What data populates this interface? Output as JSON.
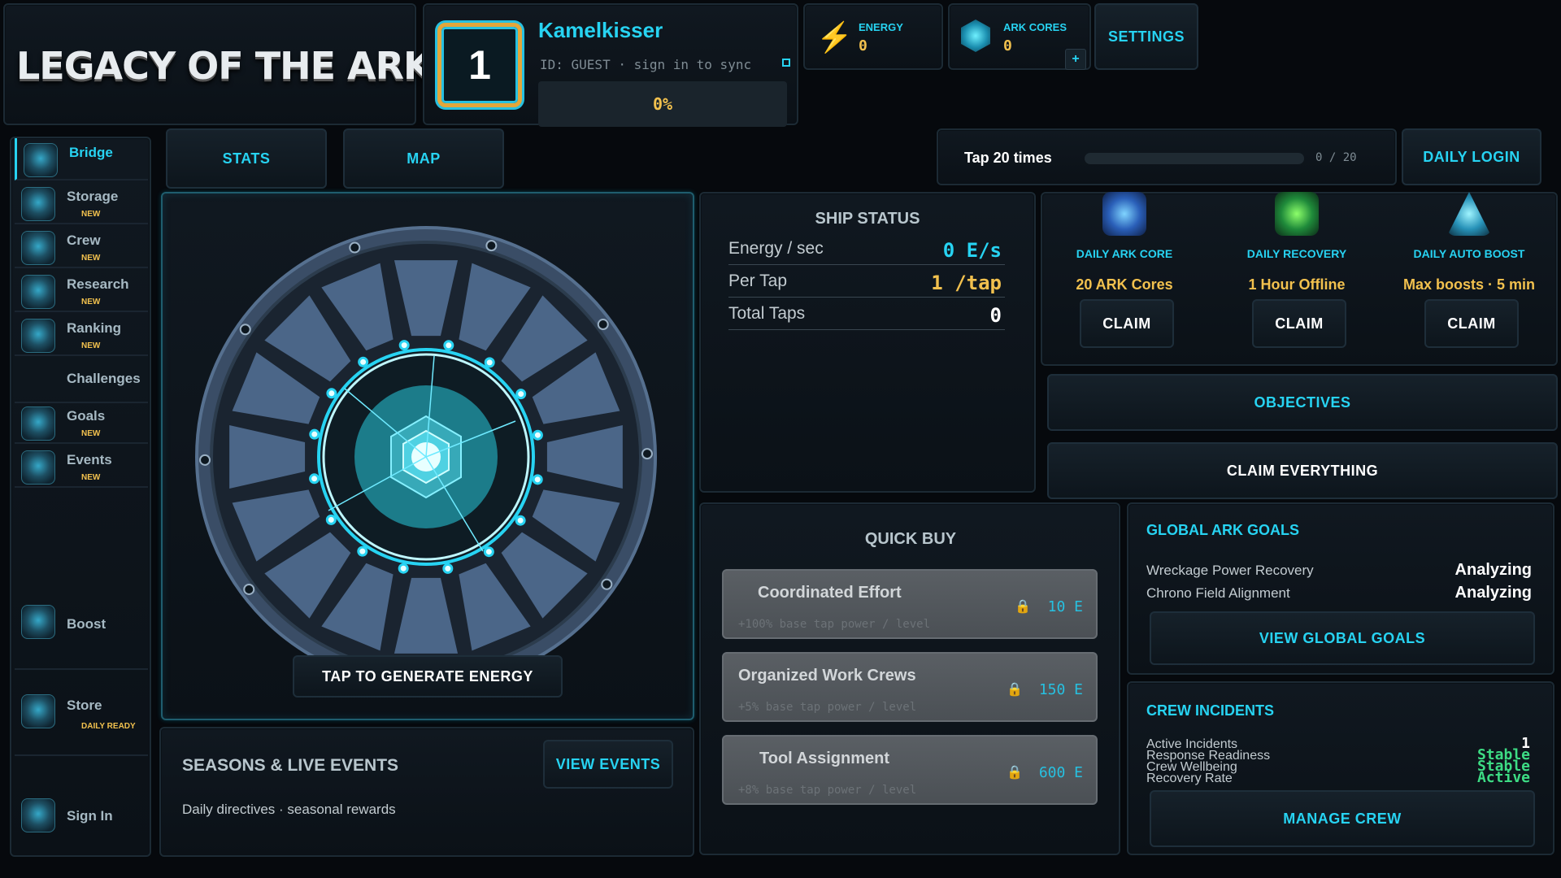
{
  "header": {
    "logo_text": "LEGACY OF THE ARK",
    "level": "1",
    "username": "Kamelkisser",
    "user_id": "ID: GUEST · sign in to sync",
    "progress_text": "0%",
    "energy_label": "ENERGY",
    "energy_value": "0",
    "ark_cores_label": "ARK CORES",
    "ark_cores_value": "0",
    "add_symbol": "+",
    "settings_label": "SETTINGS"
  },
  "sidebar": {
    "items": [
      {
        "label": "Bridge",
        "badge": ""
      },
      {
        "label": "Storage",
        "badge": "NEW"
      },
      {
        "label": "Crew",
        "badge": "NEW"
      },
      {
        "label": "Research",
        "badge": "NEW"
      },
      {
        "label": "Ranking",
        "badge": "NEW"
      },
      {
        "label": "Challenges",
        "badge": ""
      },
      {
        "label": "Goals",
        "badge": "NEW"
      },
      {
        "label": "Events",
        "badge": "NEW"
      },
      {
        "label": "Boost",
        "badge": ""
      },
      {
        "label": "Store",
        "badge": "DAILY READY"
      },
      {
        "label": "Sign In",
        "badge": ""
      }
    ]
  },
  "tabs": {
    "stats": "STATS",
    "map": "MAP"
  },
  "task": {
    "label": "Tap 20 times",
    "progress_text": "0 / 20",
    "progress_fraction": 0,
    "daily_login": "DAILY LOGIN"
  },
  "reactor": {
    "tap_label": "TAP TO GENERATE ENERGY"
  },
  "ship_status": {
    "title": "SHIP STATUS",
    "rows": [
      {
        "label": "Energy / sec",
        "value": "0 E/s"
      },
      {
        "label": "Per Tap",
        "value": "1 /tap"
      },
      {
        "label": "Total Taps",
        "value": "0"
      }
    ]
  },
  "rewards": [
    {
      "title": "DAILY ARK CORE",
      "value": "20 ARK Cores",
      "button": "CLAIM"
    },
    {
      "title": "DAILY RECOVERY",
      "value": "1 Hour Offline",
      "button": "CLAIM"
    },
    {
      "title": "DAILY AUTO BOOST",
      "value": "Max boosts · 5 min",
      "button": "CLAIM"
    }
  ],
  "objectives_label": "OBJECTIVES",
  "claim_everything_label": "CLAIM EVERYTHING",
  "quick_buy": {
    "title": "QUICK BUY",
    "items": [
      {
        "name": "Coordinated Effort",
        "desc": "+100% base tap power / level",
        "price": "10 E"
      },
      {
        "name": "Organized Work Crews",
        "desc": "+5% base tap power / level",
        "price": "150 E"
      },
      {
        "name": "Tool Assignment",
        "desc": "+8% base tap power / level",
        "price": "600 E"
      }
    ]
  },
  "global_goals": {
    "title": "GLOBAL ARK GOALS",
    "rows": [
      {
        "label": "Wreckage Power Recovery",
        "value": "Analyzing"
      },
      {
        "label": "Chrono Field Alignment",
        "value": "Analyzing"
      }
    ],
    "button": "VIEW GLOBAL GOALS"
  },
  "crew_incidents": {
    "title": "CREW INCIDENTS",
    "rows": [
      {
        "label": "Active Incidents",
        "value": "1"
      },
      {
        "label": "Response Readiness",
        "value": "Stable"
      },
      {
        "label": "Crew Wellbeing",
        "value": "Stable"
      },
      {
        "label": "Recovery Rate",
        "value": "Active"
      }
    ],
    "button": "MANAGE CREW"
  },
  "seasons": {
    "title": "SEASONS & LIVE EVENTS",
    "subtitle": "Daily directives · seasonal rewards",
    "button": "VIEW EVENTS"
  },
  "colors": {
    "accent": "#27d3f2",
    "gold": "#f2c14e",
    "green": "#3ddc84",
    "background": "#06090d"
  }
}
